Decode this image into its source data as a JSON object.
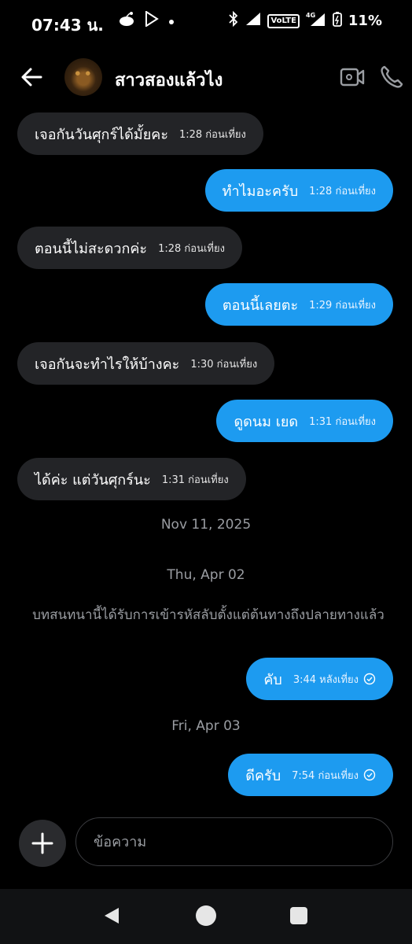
{
  "status_bar": {
    "time": "07:43 น.",
    "battery": "11%",
    "network": "4G",
    "volte": "VoLTE"
  },
  "header": {
    "contact_name": "สาวสองแล้วไง"
  },
  "messages": [
    {
      "text": "เจอกันวันศุกร์ได้มั้ยคะ",
      "time": "1:28 ก่อนเที่ยง"
    },
    {
      "text": "ทำไมอะครับ",
      "time": "1:28 ก่อนเที่ยง"
    },
    {
      "text": "ตอนนี้ไม่สะดวกค่ะ",
      "time": "1:28 ก่อนเที่ยง"
    },
    {
      "text": "ตอนนี้เลยตะ",
      "time": "1:29 ก่อนเที่ยง"
    },
    {
      "text": "เจอกันจะทำไรให้บ้างคะ",
      "time": "1:30 ก่อนเที่ยง"
    },
    {
      "text": "ดูดนม เยด",
      "time": "1:31 ก่อนเที่ยง"
    },
    {
      "text": "ได้ค่ะ  แต่วันศุกร์นะ",
      "time": "1:31 ก่อนเที่ยง"
    },
    {
      "text": "คับ",
      "time": "3:44 หลังเที่ยง"
    },
    {
      "text": "ดีครับ",
      "time": "7:54 ก่อนเที่ยง"
    }
  ],
  "dates": {
    "d1": "Nov 11, 2025",
    "d2": "Thu, Apr 02",
    "d3": "Fri, Apr 03"
  },
  "encryption_note": "บทสนทนานี้ได้รับการเข้ารหัสลับตั้งแต่ต้นทางถึงปลายทางแล้ว",
  "composer": {
    "placeholder": "ข้อความ"
  },
  "colors": {
    "outgoing_bubble": "#1d9bf0",
    "incoming_bubble": "#232427",
    "background": "#000000"
  }
}
